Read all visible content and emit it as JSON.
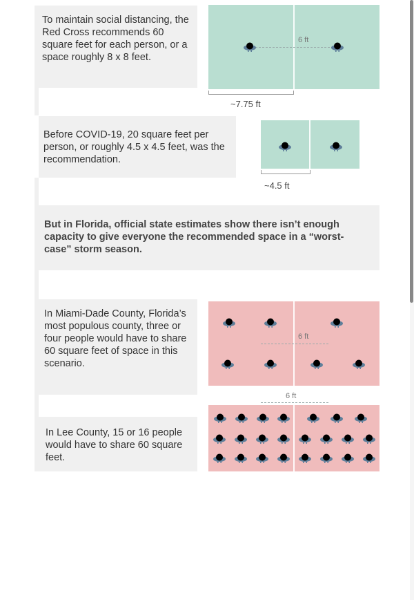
{
  "section_1": {
    "text": "To maintain social distancing, the Red Cross recommends 60 square feet for each person, or a space roughly 8 x 8 feet.",
    "distance_label": "6 ft",
    "width_label": "~7.75 ft"
  },
  "section_2": {
    "text": "Before COVID-19, 20 square feet per person, or roughly 4.5 x 4.5 feet, was the recommendation.",
    "width_label": "~4.5 ft"
  },
  "section_3": {
    "text": "But in Florida, official state estimates show there isn’t enough capacity to give everyone the recommended space in a “worst-case” storm season."
  },
  "section_4": {
    "text": "In Miami-Dade County, Florida’s most populous county, three or four people would have to share 60 square feet of space in this scenario.",
    "distance_label": "6 ft"
  },
  "section_5": {
    "text": "In Lee County, 15 or 16 people would have to share 60 square feet.",
    "distance_label": "6 ft"
  },
  "colors": {
    "green_room": "#b9ded1",
    "pink_room": "#f0bcbc",
    "text_panel": "#f0f0f0",
    "person_head": "#000000",
    "person_shoulders": "#5f7f9a"
  },
  "icons": {
    "person": "person-topdown-icon"
  }
}
